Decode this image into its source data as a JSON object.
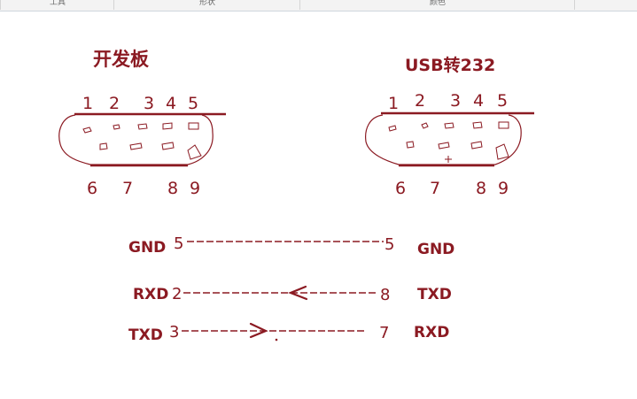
{
  "ribbon": {
    "tabs": [
      "工具",
      "形状",
      "颜色"
    ]
  },
  "connectors": {
    "left": {
      "title": "开发板",
      "top_pins": [
        "1",
        "2",
        "3",
        "4",
        "5"
      ],
      "bottom_pins": [
        "6",
        "7",
        "8",
        "9"
      ]
    },
    "right": {
      "title": "USB转232",
      "top_pins": [
        "1",
        "2",
        "3",
        "4",
        "5"
      ],
      "bottom_pins": [
        "6",
        "7",
        "8",
        "9"
      ]
    }
  },
  "wiring": {
    "gnd": {
      "left_label": "GND",
      "left_pin": "5",
      "right_pin": "5",
      "right_label": "GND"
    },
    "rxd": {
      "left_label": "RXD",
      "left_pin": "2",
      "right_pin": "8",
      "right_label": "TXD"
    },
    "txd": {
      "left_label": "TXD",
      "left_pin": "3",
      "right_pin": "7",
      "right_label": "RXD"
    }
  },
  "colors": {
    "ink": "#8b1a22",
    "ribbon_bg": "#f3f3f3"
  }
}
